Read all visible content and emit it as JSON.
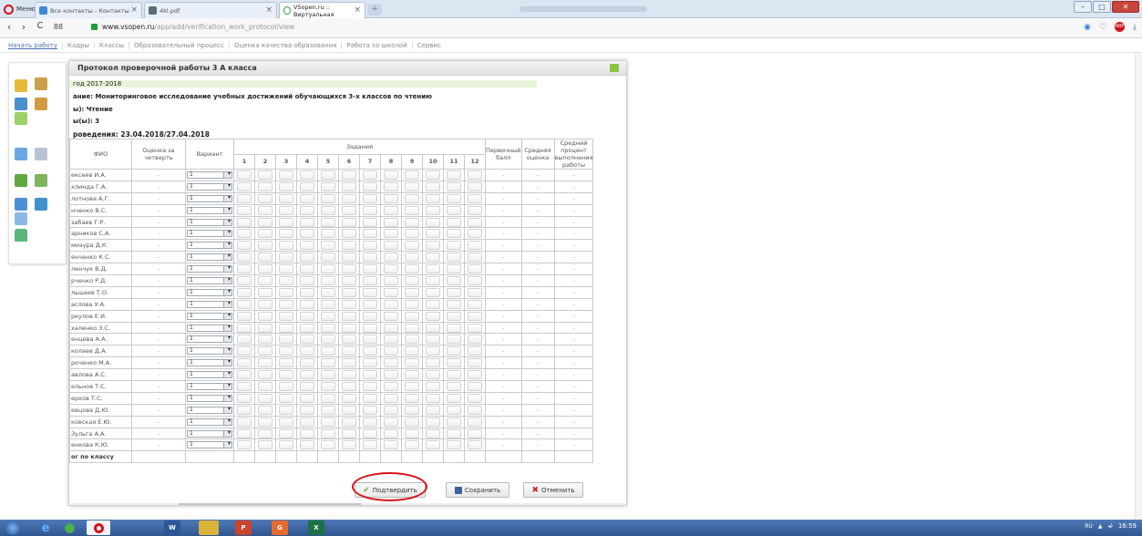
{
  "browser": {
    "menu_label": "Меню",
    "tabs": [
      {
        "label": "Все контакты - Контакты",
        "active": false
      },
      {
        "label": "4kl.pdf",
        "active": false
      },
      {
        "label": "VSopen.ru :: Виртуальная",
        "active": true
      }
    ],
    "new_tab": "+",
    "url_host": "www.vsopen.ru",
    "url_path": "/app/add/verification_work_protocol/view",
    "nav": {
      "back": "‹",
      "forward": "›",
      "reload": "C",
      "speed_dial": "88"
    },
    "window_controls": {
      "minimize": "–",
      "maximize": "□",
      "close": "✕"
    }
  },
  "bookmarks": [
    "Начать работу",
    "Кадры",
    "Классы",
    "Образовательный процесс",
    "Оценка качества образования",
    "Работа со школой",
    "Сервис"
  ],
  "dialog": {
    "title": "Протокол проверочной работы 3 А класса",
    "info": {
      "year": "год 2017-2018",
      "name": "ание: Мониторинговое исследование учебных достижений обучающихся 3-х классов по чтению",
      "subject": "ы): Чтение",
      "grade": "ы(ы): 3",
      "dates": "роведения: 23.04.2018/27.04.2018"
    },
    "table": {
      "headers": {
        "fio": "ФИО",
        "quarter_grade": "Оценка за четверть",
        "variant": "Вариант",
        "tasks": "Задания",
        "primary_score": "Первичный балл",
        "average_grade": "Средняя оценка",
        "average_percent": "Средний процент выполнения работы"
      },
      "task_numbers": [
        "1",
        "2",
        "3",
        "4",
        "5",
        "6",
        "7",
        "8",
        "9",
        "10",
        "11",
        "12"
      ],
      "rows": [
        {
          "fio": "ексеев И.А.",
          "grade": "-",
          "variant": "1",
          "score": "-",
          "avg": "-",
          "pct": "-"
        },
        {
          "fio": "хлинда Г.А.",
          "grade": "-",
          "variant": "1",
          "score": "-",
          "avg": "-",
          "pct": "-"
        },
        {
          "fio": "лотнова А.Г.",
          "grade": "-",
          "variant": "1",
          "score": "-",
          "avg": "-",
          "pct": "-"
        },
        {
          "fio": "нченко В.С.",
          "grade": "-",
          "variant": "1",
          "score": "-",
          "avg": "-",
          "pct": "-"
        },
        {
          "fio": "забаев Г.Р.",
          "grade": "-",
          "variant": "1",
          "score": "-",
          "avg": "-",
          "pct": "-"
        },
        {
          "fio": "арников С.А.",
          "grade": "-",
          "variant": "1",
          "score": "-",
          "avg": "-",
          "pct": "-"
        },
        {
          "fio": "миэура Д.К.",
          "grade": "-",
          "variant": "1",
          "score": "-",
          "avg": "-",
          "pct": "-"
        },
        {
          "fio": "енченко К.С.",
          "grade": "-",
          "variant": "1",
          "score": "-",
          "avg": "-",
          "pct": "-"
        },
        {
          "fio": "ленчук В.Д.",
          "grade": "-",
          "variant": "1",
          "score": "-",
          "avg": "-",
          "pct": "-"
        },
        {
          "fio": "рченко Р.Д.",
          "grade": "-",
          "variant": "1",
          "score": "-",
          "avg": "-",
          "pct": "-"
        },
        {
          "fio": "льшаев Т.О.",
          "grade": "-",
          "variant": "1",
          "score": "-",
          "avg": "-",
          "pct": "-"
        },
        {
          "fio": "аслова У.А.",
          "grade": "-",
          "variant": "1",
          "score": "-",
          "avg": "-",
          "pct": "-"
        },
        {
          "fio": "ркулов Е.И.",
          "grade": "-",
          "variant": "1",
          "score": "-",
          "avg": "-",
          "pct": "-"
        },
        {
          "fio": "халенко З.С.",
          "grade": "-",
          "variant": "1",
          "score": "-",
          "avg": "-",
          "pct": "-"
        },
        {
          "fio": "енцева А.А.",
          "grade": "-",
          "variant": "1",
          "score": "-",
          "avg": "-",
          "pct": "-"
        },
        {
          "fio": "колаев Д.А.",
          "grade": "-",
          "variant": "1",
          "score": "-",
          "avg": "-",
          "pct": "-"
        },
        {
          "fio": "роченко М.А.",
          "grade": "-",
          "variant": "1",
          "score": "-",
          "avg": "-",
          "pct": "-"
        },
        {
          "fio": "авлова А.С.",
          "grade": "-",
          "variant": "1",
          "score": "-",
          "avg": "-",
          "pct": "-"
        },
        {
          "fio": "ельнов Т.С.",
          "grade": "-",
          "variant": "1",
          "score": "-",
          "avg": "-",
          "pct": "-"
        },
        {
          "fio": "ерков Т.С.",
          "grade": "-",
          "variant": "1",
          "score": "-",
          "avg": "-",
          "pct": "-"
        },
        {
          "fio": "евцова Д.Ю.",
          "grade": "-",
          "variant": "1",
          "score": "-",
          "avg": "-",
          "pct": "-"
        },
        {
          "fio": "ковская Е.Ю.",
          "grade": "-",
          "variant": "1",
          "score": "-",
          "avg": "-",
          "pct": "-"
        },
        {
          "fio": "Зульга А.А.",
          "grade": "-",
          "variant": "1",
          "score": "-",
          "avg": "-",
          "pct": "-"
        },
        {
          "fio": "енкова К.Ю.",
          "grade": "-",
          "variant": "1",
          "score": "-",
          "avg": "-",
          "pct": "-"
        }
      ],
      "total_label": "ог по классу"
    },
    "buttons": {
      "confirm": "Подтвердить",
      "save": "Сохранить",
      "cancel": "Отменить"
    }
  },
  "taskbar": {
    "lang": "RU",
    "time": "16:59",
    "apps": [
      "W",
      "P",
      "G",
      "X"
    ]
  },
  "colors": {
    "accent_green": "#8ac43f",
    "highlight_red": "#d3141b",
    "taskbar": "#2f568f"
  }
}
